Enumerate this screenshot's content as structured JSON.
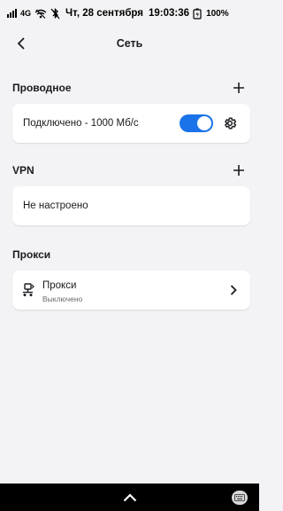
{
  "status_bar": {
    "network": "4G",
    "date": "Чт, 28 сентября",
    "time": "19:03:36",
    "battery": "100%",
    "icons": [
      "signal-icon",
      "wifi-off-icon",
      "bluetooth-off-icon",
      "battery-charging-icon"
    ]
  },
  "header": {
    "title": "Сеть",
    "back_icon": "arrow-back-icon"
  },
  "sections": {
    "wired": {
      "title": "Проводное",
      "add_icon": "plus-icon",
      "connection_label": "Подключено - 1000 Мб/с",
      "toggle_on": true,
      "settings_icon": "gear-icon"
    },
    "vpn": {
      "title": "VPN",
      "add_icon": "plus-icon",
      "status": "Не настроено"
    },
    "proxy": {
      "title": "Прокси",
      "item_title": "Прокси",
      "item_subtitle": "Выключено",
      "item_icon": "proxy-icon",
      "chevron_icon": "chevron-right-icon"
    }
  },
  "nav_bar": {
    "up_icon": "chevron-up-icon",
    "keyboard_icon": "keyboard-icon"
  },
  "colors": {
    "accent": "#1a73e8",
    "background": "#f3f3f5",
    "card": "#ffffff"
  }
}
